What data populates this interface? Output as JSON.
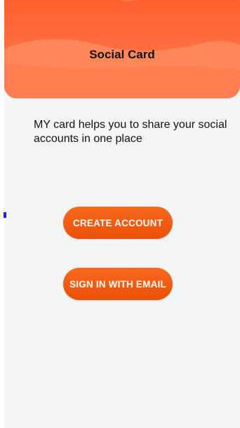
{
  "header": {
    "title": "Social Card"
  },
  "intro": {
    "text": "MY card helps you to share your social accounts in one place"
  },
  "actions": {
    "create_account_label": "CREATE ACCOUNT",
    "sign_in_email_label": "SIGN IN WITH EMAIL"
  },
  "colors": {
    "header_top": "#ff5a2a",
    "header_wave": "#ff8a5c",
    "button": "#f15a0f",
    "background": "#f4f6f5"
  }
}
